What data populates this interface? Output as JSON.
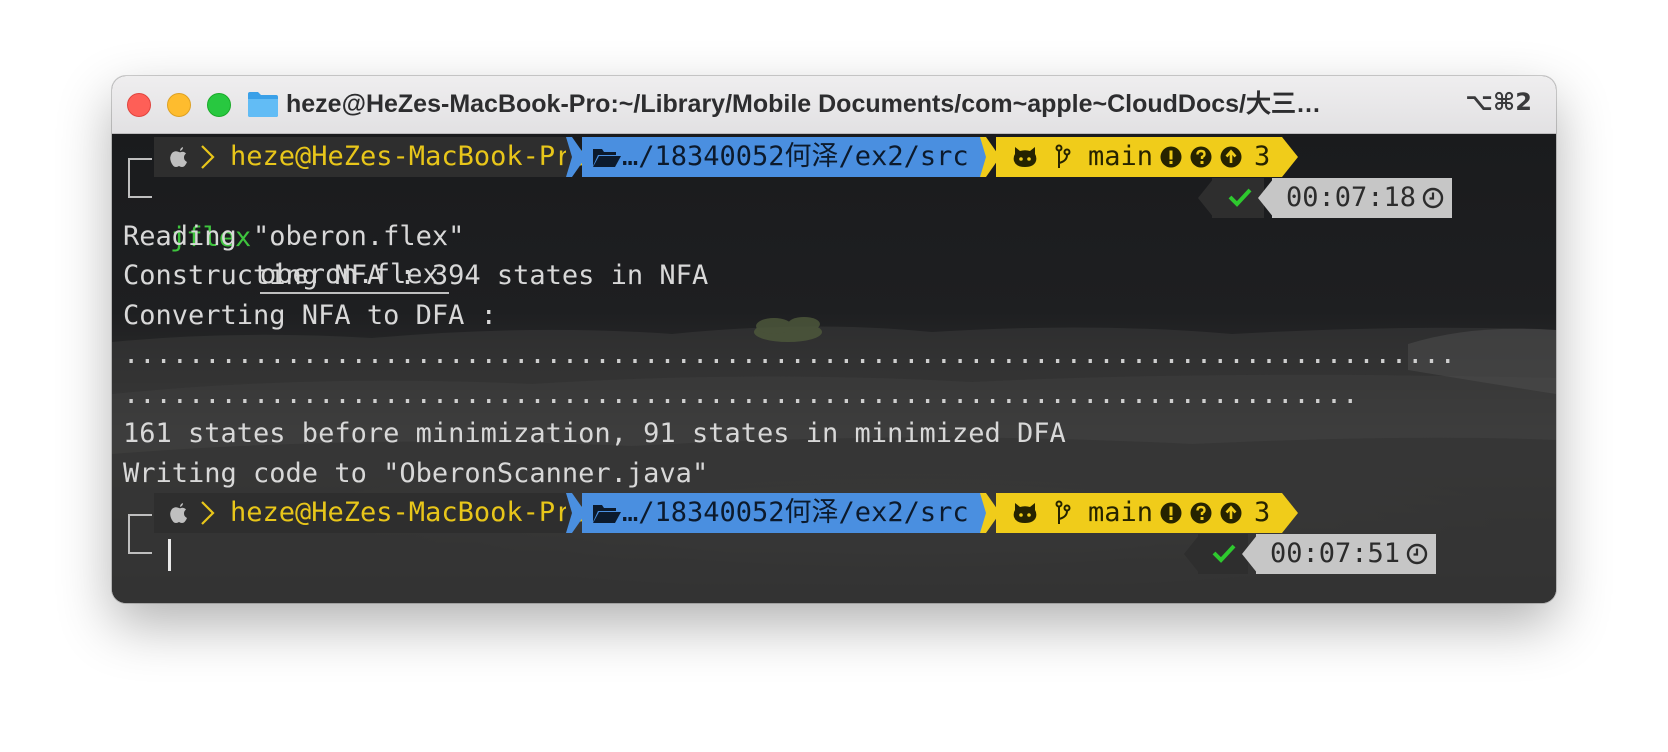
{
  "window": {
    "title": "heze@HeZes-MacBook-Pro:~/Library/Mobile Documents/com~apple~CloudDocs/大三…",
    "shortcut": "⌥⌘2"
  },
  "prompts": [
    {
      "user_host": "heze@HeZes-MacBook-Pro",
      "path": "…/18340052何泽/ex2/src",
      "branch": "main",
      "ahead_count": "3",
      "time": "00:07:18",
      "command": "jflex",
      "argument": "oberon.flex"
    },
    {
      "user_host": "heze@HeZes-MacBook-Pro",
      "path": "…/18340052何泽/ex2/src",
      "branch": "main",
      "ahead_count": "3",
      "time": "00:07:51"
    }
  ],
  "output": [
    "Reading \"oberon.flex\"",
    "Constructing NFA : 394 states in NFA",
    "Converting NFA to DFA :",
    "..................................................................................",
    "............................................................................",
    "161 states before minimization, 91 states in minimized DFA",
    "Writing code to \"OberonScanner.java\""
  ],
  "colors": {
    "path_segment": "#4a8fe0",
    "git_segment": "#f0cc1a",
    "user_host_text": "#e8c61a",
    "command_text": "#3ec43e",
    "status_ok": "#2ec82e",
    "time_segment": "#c6c6c6"
  },
  "icons": [
    "apple-icon",
    "chevron-right-icon",
    "folder-open-icon",
    "github-icon",
    "git-branch-icon",
    "exclamation-circle-icon",
    "question-circle-icon",
    "arrow-up-circle-icon",
    "check-icon",
    "clock-icon"
  ]
}
